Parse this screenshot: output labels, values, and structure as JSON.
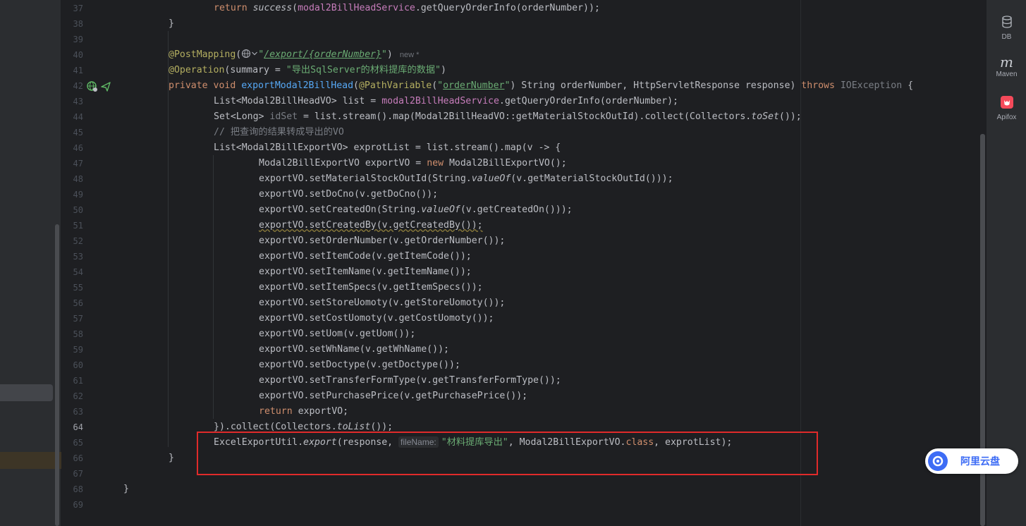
{
  "lines": [
    {
      "num": "37"
    },
    {
      "num": "38"
    },
    {
      "num": "39"
    },
    {
      "num": "40"
    },
    {
      "num": "41"
    },
    {
      "num": "42"
    },
    {
      "num": "43"
    },
    {
      "num": "44"
    },
    {
      "num": "45"
    },
    {
      "num": "46"
    },
    {
      "num": "47"
    },
    {
      "num": "48"
    },
    {
      "num": "49"
    },
    {
      "num": "50"
    },
    {
      "num": "51"
    },
    {
      "num": "52"
    },
    {
      "num": "53"
    },
    {
      "num": "54"
    },
    {
      "num": "55"
    },
    {
      "num": "56"
    },
    {
      "num": "57"
    },
    {
      "num": "58"
    },
    {
      "num": "59"
    },
    {
      "num": "60"
    },
    {
      "num": "61"
    },
    {
      "num": "62"
    },
    {
      "num": "63"
    },
    {
      "num": "64"
    },
    {
      "num": "65"
    },
    {
      "num": "66"
    },
    {
      "num": "67"
    },
    {
      "num": "68"
    },
    {
      "num": "69"
    }
  ],
  "code": {
    "l37": {
      "a": "return ",
      "b": "success",
      "c": "(",
      "d": "modal2BillHeadService",
      "e": ".getQueryOrderInfo(orderNumber));"
    },
    "l38": "}",
    "l40": {
      "ann": "@PostMapping",
      "open": "(",
      "q1": "\"",
      "path": "/export/{orderNumber}",
      "q2": "\"",
      "close": ")",
      "new": "new *"
    },
    "l41": {
      "ann": "@Operation",
      "open": "(summary = ",
      "str": "\"导出SqlServer的材料提库的数据\"",
      "close": ")"
    },
    "l42": {
      "kw1": "private ",
      "kw2": "void ",
      "fn": "exportModal2BillHead",
      "p1": "(",
      "ann": "@PathVariable",
      "p2": "(",
      "q1": "\"",
      "pv": "orderNumber",
      "q2": "\"",
      "p3": ") String orderNumber, HttpServletResponse response) ",
      "kw3": "throws ",
      "exc": "IOException",
      "p4": " {"
    },
    "l43": {
      "a": "List<Modal2BillHeadVO> list = ",
      "b": "modal2BillHeadService",
      "c": ".getQueryOrderInfo(orderNumber);"
    },
    "l44": {
      "a": "Set<Long> ",
      "b": "idSet",
      "c": " = list.stream().map(Modal2BillHeadVO::getMaterialStockOutId).collect(Collectors.",
      "d": "toSet",
      "e": "());"
    },
    "l45": "// 把查询的结果转成导出的VO",
    "l46": "List<Modal2BillExportVO> exprotList = list.stream().map(v -> {",
    "l47": {
      "a": "Modal2BillExportVO exportVO = ",
      "kw": "new ",
      "b": "Modal2BillExportVO();"
    },
    "l48": {
      "a": "exportVO.setMaterialStockOutId(String.",
      "b": "valueOf",
      "c": "(v.getMaterialStockOutId()));"
    },
    "l49": "exportVO.setDoCno(v.getDoCno());",
    "l50": {
      "a": "exportVO.setCreatedOn(String.",
      "b": "valueOf",
      "c": "(v.getCreatedOn()));"
    },
    "l51": "exportVO.setCreatedBy(v.getCreatedBy());",
    "l52": "exportVO.setOrderNumber(v.getOrderNumber());",
    "l53": "exportVO.setItemCode(v.getItemCode());",
    "l54": "exportVO.setItemName(v.getItemName());",
    "l55": "exportVO.setItemSpecs(v.getItemSpecs());",
    "l56": "exportVO.setStoreUomoty(v.getStoreUomoty());",
    "l57": "exportVO.setCostUomoty(v.getCostUomoty());",
    "l58": "exportVO.setUom(v.getUom());",
    "l59": "exportVO.setWhName(v.getWhName());",
    "l60": "exportVO.setDoctype(v.getDoctype());",
    "l61": "exportVO.setTransferFormType(v.getTransferFormType());",
    "l62": "exportVO.setPurchasePrice(v.getPurchasePrice());",
    "l63": {
      "kw": "return ",
      "a": "exportVO;"
    },
    "l64": {
      "a": "}).collect(Collectors.",
      "b": "toList",
      "c": "());"
    },
    "l65": {
      "a": "ExcelExportUtil.",
      "b": "export",
      "c": "(response, ",
      "hint": "fileName:",
      "str": "\"材料提库导出\"",
      "d": ", Modal2BillExportVO.",
      "kw": "class",
      "e": ", exprotList);"
    },
    "l66": "}",
    "l68": "}"
  },
  "right_tools": [
    {
      "label": "DB",
      "icon": "database-icon"
    },
    {
      "label": "Maven",
      "icon": "maven-icon",
      "glyph": "m"
    },
    {
      "label": "Apifox",
      "icon": "apifox-icon"
    }
  ],
  "aliyun": {
    "label": "阿里云盘"
  }
}
